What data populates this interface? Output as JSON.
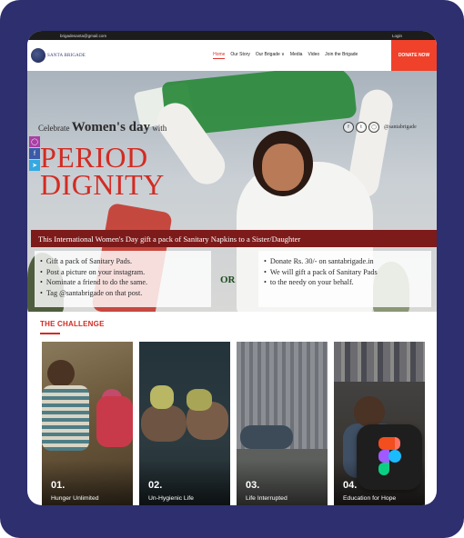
{
  "top_bar": {
    "email": "brigadesanta@gmail.com",
    "login": "Login"
  },
  "brand": {
    "name": "SANTA BRIGADE"
  },
  "nav": {
    "items": [
      "Home",
      "Our Story",
      "Our Brigade ∨",
      "Media",
      "Video",
      "Join the Brigade"
    ],
    "active": "Home",
    "donate_label": "DONATE NOW"
  },
  "hero": {
    "celebrate_prefix": "Celebrate",
    "celebrate_emphasis": "Women's day",
    "celebrate_suffix": "with",
    "headline_line1": "PERIOD",
    "headline_line2": "DIGNITY",
    "handle": "@santabrigade",
    "banner": "This International Women's Day gift a pack of Sanitary Napkins to a Sister/Daughter",
    "left_steps": [
      "Gift a pack of Sanitary Pads.",
      "Post a picture on your instagram.",
      "Nominate a friend to do the same.",
      "Tag @santabrigade on that post."
    ],
    "or_label": "OR",
    "right_steps": [
      "Donate Rs. 30/- on santabrigade.in",
      "We will gift a pack of Sanitary Pads",
      "to the needy on your behalf."
    ]
  },
  "social_icons": [
    "instagram-icon",
    "facebook-icon",
    "twitter-icon"
  ],
  "social_colors": {
    "instagram": "#a93fa5",
    "facebook": "#3b5ba8",
    "twitter": "#35a8e0"
  },
  "challenge": {
    "heading": "THE CHALLENGE",
    "cards": [
      {
        "number": "01.",
        "title": "Hunger Unlimited"
      },
      {
        "number": "02.",
        "title": "Un-Hygienic Life"
      },
      {
        "number": "03.",
        "title": "Life Interrupted"
      },
      {
        "number": "04.",
        "title": "Education for Hope"
      }
    ]
  },
  "colors": {
    "frame": "#2d2f6e",
    "accent_red": "#d32b23",
    "banner": "#7d1a1a",
    "donate": "#f0412b"
  }
}
